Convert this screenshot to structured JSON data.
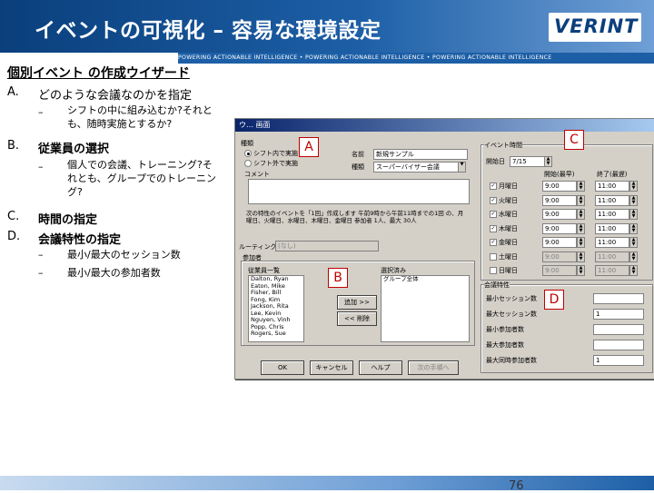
{
  "slide": {
    "title": "イベントの可視化 – 容易な環境設定",
    "logo": "VERINT",
    "tagline": "POWERING ACTIONABLE INTELLIGENCE • POWERING ACTIONABLE INTELLIGENCE • POWERING ACTIONABLE INTELLIGENCE",
    "page_number": "76"
  },
  "content": {
    "subtitle": "個別イベント の作成ウイザード",
    "items": [
      {
        "marker": "A.",
        "text": "どのような会議なのかを指定"
      },
      {
        "marker": "B.",
        "text": "従業員の選択"
      },
      {
        "marker": "C.",
        "text": "時間の指定"
      },
      {
        "marker": "D.",
        "text": "会議特性の指定"
      }
    ],
    "subitems": {
      "a1": "シフトの中に組み込むか?それとも、随時実施とするか?",
      "b1": "個人での会議、トレーニング?それとも、グループでのトレーニング?",
      "d1": "最小/最大のセッション数",
      "d2": "最小/最大の参加者数"
    },
    "dash": "–"
  },
  "dialog": {
    "title": "ウ… 画面",
    "markers": {
      "a": "A",
      "b": "B",
      "c": "C",
      "d": "D"
    },
    "type_label": "種類",
    "radio1": "シフト内で実施",
    "radio2": "シフト外で実施",
    "comment_label": "コメント",
    "name_label": "名前",
    "name_value": "新規サンプル",
    "kind_label": "種類",
    "kind_value": "スーパーバイザー会議",
    "note_text": "次の特性のイベントを「1回」作成します 午前9時から午前11時までの1回 の、月曜日、火曜日、水曜日、木曜日、金曜日 参加者 1人、最大 30人",
    "link_label": "ルーティング",
    "link_value": "(なし)",
    "participants_label": "参加者",
    "employee_list_label": "従業員一覧",
    "employees": [
      "Dalton, Ryan",
      "Eaton, Mike",
      "Fisher, Bill",
      "Fong, Kim",
      "Jackson, Rita",
      "Lee, Kevin",
      "Nguyen, Vinh",
      "Popp, Chris",
      "Rogers, Sue"
    ],
    "selected_label": "選択済み",
    "selected": [
      "グループ全体"
    ],
    "add_button": "追加 >>",
    "remove_button": "<< 削除",
    "time_group_label": "イベント時間",
    "date_label": "開始日",
    "date_value": "7/15",
    "col_start": "開始(最早)",
    "col_end": "終了(最遅)",
    "days": [
      {
        "day": "月曜日",
        "checked": true,
        "start": "9:00",
        "end": "11:00"
      },
      {
        "day": "火曜日",
        "checked": true,
        "start": "9:00",
        "end": "11:00"
      },
      {
        "day": "水曜日",
        "checked": true,
        "start": "9:00",
        "end": "11:00"
      },
      {
        "day": "木曜日",
        "checked": true,
        "start": "9:00",
        "end": "11:00"
      },
      {
        "day": "金曜日",
        "checked": true,
        "start": "9:00",
        "end": "11:00"
      },
      {
        "day": "土曜日",
        "checked": false,
        "start": "9:00",
        "end": "11:00"
      },
      {
        "day": "日曜日",
        "checked": false,
        "start": "9:00",
        "end": "11:00"
      }
    ],
    "props_label": "会議特性",
    "props": [
      {
        "label": "最小セッション数",
        "value": ""
      },
      {
        "label": "最大セッション数",
        "value": "1"
      },
      {
        "label": "最小参加者数",
        "value": ""
      },
      {
        "label": "最大参加者数",
        "value": ""
      },
      {
        "label": "最大同時参加者数",
        "value": "1"
      }
    ],
    "buttons": [
      "OK",
      "キャンセル",
      "ヘルプ",
      "次の手順へ"
    ]
  }
}
